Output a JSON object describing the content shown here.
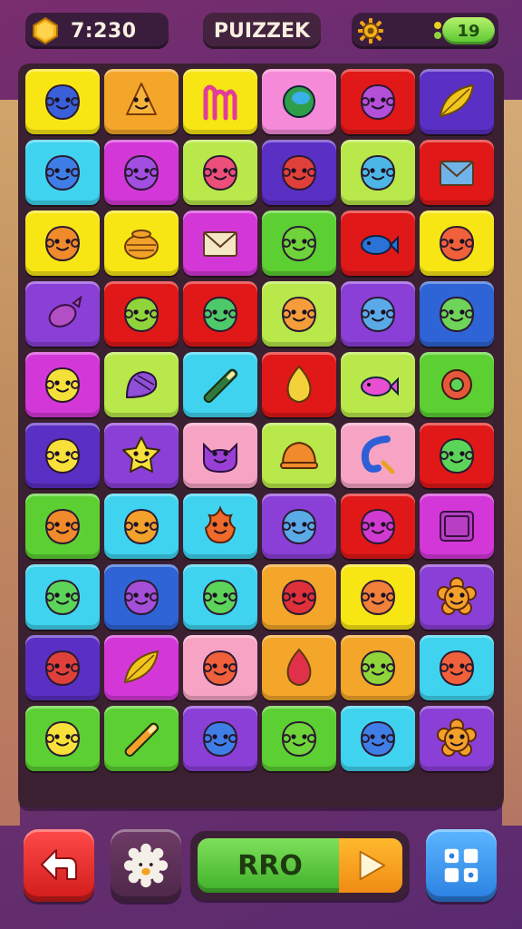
{
  "hud": {
    "timer": "7:230",
    "title": "PUIZZEK",
    "score": "19"
  },
  "controls": {
    "play_label": "RRO"
  },
  "colors": {
    "yellow": "#f7e614",
    "orange": "#f4a62a",
    "pink": "#f58ad8",
    "red": "#e01818",
    "blue": "#3d5ed9",
    "purple": "#8a3fd6",
    "cyan": "#3fd3f0",
    "magenta": "#d437d8",
    "lime": "#b8e84a",
    "green": "#5ccf33",
    "indigo": "#5a2fc4",
    "rose": "#f7a4c4",
    "deepblue": "#2f64d6"
  },
  "board": {
    "rows": [
      [
        "yellow:blob:#3a5fd8",
        "orange:fox:#f7b23a",
        "yellow:letter:#e13c9a",
        "pink:orb:#2e9e4a",
        "red:blob:#b34fd8",
        "indigo:leaf:#f2c51c"
      ],
      [
        "cyan:blob:#3f7ee6",
        "magenta:blob:#a14fe0",
        "lime:blob:#ec4f7a",
        "indigo:blob:#e0403a",
        "lime:blob:#4cb7e6",
        "red:envelope:#6fb3e8"
      ],
      [
        "yellow:blob:#f08a2a",
        "yellow:pot:#f2a12a",
        "magenta:envelope:#f5e6c4",
        "green:blob:#6ed43a",
        "red:fish:#2a72d6",
        "yellow:blob:#f0603a"
      ],
      [
        "purple:candy:#b24fc4",
        "red:blob:#8fd43a",
        "red:blob:#4ec96a",
        "lime:blob:#f59d3a",
        "purple:blob:#5aaae8",
        "deepblue:blob:#6fd45a"
      ],
      [
        "magenta:blob:#f5e03a",
        "lime:mitt:#8f4fd6",
        "cyan:stick:#2f7a3a",
        "red:drop:#f2d13a",
        "lime:fish:#e84fd0",
        "green:gear:#e4573a"
      ],
      [
        "indigo:blob:#f7e03a",
        "purple:star:#f7e03a",
        "rose:cat:#9a3fd6",
        "lime:cap:#f08a2a",
        "rose:hook:#2f5fd6",
        "red:blob:#5cd45a"
      ],
      [
        "green:blob:#f08a2a",
        "cyan:blob:#f2a12a",
        "cyan:flame:#f06a2a",
        "purple:blob:#5aaae8",
        "red:blob:#d03ad0",
        "magenta:screen:#b73fc4"
      ],
      [
        "cyan:blob:#5cd45a",
        "deepblue:blob:#a44fd8",
        "cyan:blob:#5cd45a",
        "orange:blob:#e0303a",
        "yellow:blob:#f0803a",
        "purple:flower:#f5a02a"
      ],
      [
        "indigo:blob:#e0403a",
        "magenta:leaf:#f2c51c",
        "rose:blob:#f0603a",
        "orange:drop:#e0304a",
        "orange:blob:#8fd43a",
        "cyan:blob:#f0603a"
      ],
      [
        "green:blob:#f7e03a",
        "green:stick:#f5a02a",
        "purple:blob:#3f7ee6",
        "green:blob:#6ed43a",
        "cyan:blob:#3f7ee6",
        "purple:flower:#f5a02a"
      ]
    ]
  }
}
